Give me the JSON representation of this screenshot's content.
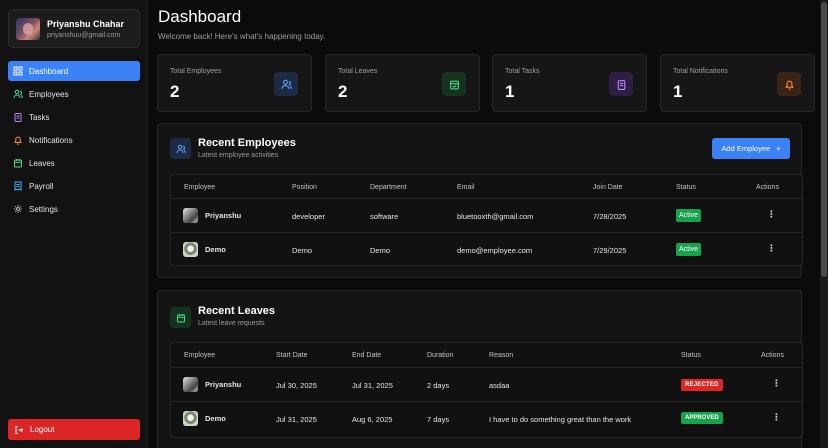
{
  "profile": {
    "name": "Priyanshu Chahar",
    "email": "priyanshuu@gmail.com"
  },
  "sidebar": {
    "items": [
      {
        "label": "Dashboard",
        "icon": "grid-icon",
        "active": true
      },
      {
        "label": "Employees",
        "icon": "users-icon"
      },
      {
        "label": "Tasks",
        "icon": "clipboard-icon"
      },
      {
        "label": "Notifications",
        "icon": "bell-icon"
      },
      {
        "label": "Leaves",
        "icon": "calendar-icon"
      },
      {
        "label": "Payroll",
        "icon": "receipt-icon"
      },
      {
        "label": "Settings",
        "icon": "gear-icon"
      }
    ],
    "logout": "Logout"
  },
  "header": {
    "title": "Dashboard",
    "subtitle": "Welcome back! Here's what's happening today."
  },
  "stats": [
    {
      "label": "Total Employees",
      "value": "2",
      "icon": "users-icon",
      "color": "#60a5fa",
      "bg": "#1e2a44"
    },
    {
      "label": "Total Leaves",
      "value": "2",
      "icon": "calendar-check-icon",
      "color": "#4ade80",
      "bg": "#163322"
    },
    {
      "label": "Total Tasks",
      "value": "1",
      "icon": "clipboard-icon",
      "color": "#c084fc",
      "bg": "#2d1f44"
    },
    {
      "label": "Total Notifications",
      "value": "1",
      "icon": "bell-icon",
      "color": "#fb923c",
      "bg": "#3a2214"
    }
  ],
  "recent_employees": {
    "title": "Recent Employees",
    "subtitle": "Latest employee activities",
    "add_button": "Add Employee",
    "columns": [
      "Employee",
      "Position",
      "Department",
      "Email",
      "Join Date",
      "Status",
      "Actions"
    ],
    "rows": [
      {
        "name": "Priyanshu",
        "position": "developer",
        "department": "software",
        "email": "bluetooxth@gmail.com",
        "join_date": "7/28/2025",
        "status": "Active"
      },
      {
        "name": "Demo",
        "position": "Demo",
        "department": "Demo",
        "email": "demo@employee.com",
        "join_date": "7/29/2025",
        "status": "Active"
      }
    ]
  },
  "recent_leaves": {
    "title": "Recent Leaves",
    "subtitle": "Latest leave requests",
    "columns": [
      "Employee",
      "Start Date",
      "End Date",
      "Duration",
      "Reason",
      "Status",
      "Actions"
    ],
    "rows": [
      {
        "name": "Priyanshu",
        "start": "Jul 30, 2025",
        "end": "Jul 31, 2025",
        "duration": "2 days",
        "reason": "asdaa",
        "status": "REJECTED"
      },
      {
        "name": "Demo",
        "start": "Jul 31, 2025",
        "end": "Aug 6, 2025",
        "duration": "7 days",
        "reason": "I have to do something great than the work",
        "status": "APPROVED"
      }
    ]
  },
  "colors": {
    "accent": "#3b82f6",
    "danger": "#dc2626",
    "success": "#16a34a"
  }
}
